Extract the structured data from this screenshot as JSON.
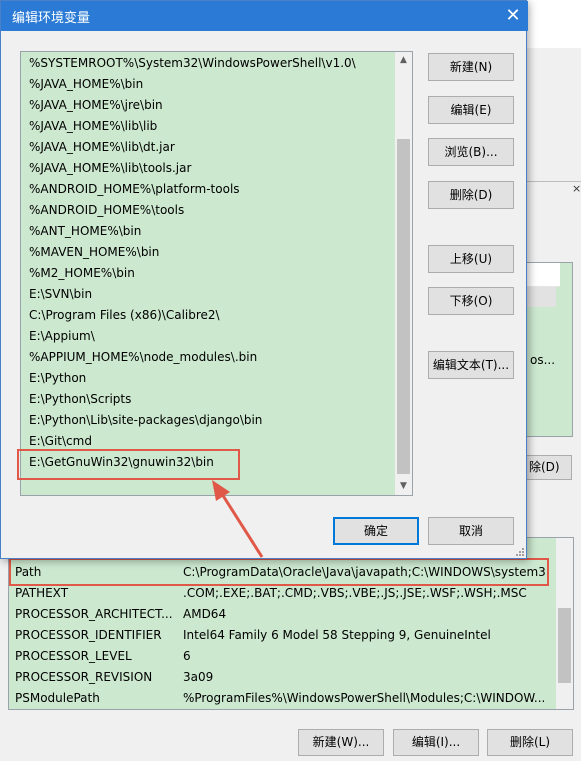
{
  "dialog": {
    "title": "编辑环境变量",
    "entries": [
      "%SYSTEMROOT%\\System32\\WindowsPowerShell\\v1.0\\",
      "%JAVA_HOME%\\bin",
      "%JAVA_HOME%\\jre\\bin",
      "%JAVA_HOME%\\lib\\lib",
      "%JAVA_HOME%\\lib\\dt.jar",
      "%JAVA_HOME%\\lib\\tools.jar",
      "%ANDROID_HOME%\\platform-tools",
      "%ANDROID_HOME%\\tools",
      "%ANT_HOME%\\bin",
      "%MAVEN_HOME%\\bin",
      "%M2_HOME%\\bin",
      "E:\\SVN\\bin",
      "C:\\Program Files (x86)\\Calibre2\\",
      "E:\\Appium\\",
      "%APPIUM_HOME%\\node_modules\\.bin",
      "E:\\Python",
      "E:\\Python\\Scripts",
      "E:\\Python\\Lib\\site-packages\\django\\bin",
      "E:\\Git\\cmd",
      "E:\\GetGnuWin32\\gnuwin32\\bin",
      ""
    ],
    "buttons": {
      "new": "新建(N)",
      "edit": "编辑(E)",
      "browse": "浏览(B)...",
      "delete": "删除(D)",
      "move_up": "上移(U)",
      "move_down": "下移(O)",
      "edit_text": "编辑文本(T)...",
      "ok": "确定",
      "cancel": "取消"
    }
  },
  "background": {
    "list_partial_text": "os...",
    "delete_button_partial": "除(D)",
    "close_glyph": "×"
  },
  "system_vars": {
    "rows": [
      {
        "name": "Path",
        "value": "C:\\ProgramData\\Oracle\\Java\\javapath;C:\\WINDOWS\\system3..."
      },
      {
        "name": "PATHEXT",
        "value": ".COM;.EXE;.BAT;.CMD;.VBS;.VBE;.JS;.JSE;.WSF;.WSH;.MSC"
      },
      {
        "name": "PROCESSOR_ARCHITECT...",
        "value": "AMD64"
      },
      {
        "name": "PROCESSOR_IDENTIFIER",
        "value": "Intel64 Family 6 Model 58 Stepping 9, GenuineIntel"
      },
      {
        "name": "PROCESSOR_LEVEL",
        "value": "6"
      },
      {
        "name": "PROCESSOR_REVISION",
        "value": "3a09"
      },
      {
        "name": "PSModulePath",
        "value": "%ProgramFiles%\\WindowsPowerShell\\Modules;C:\\WINDOW..."
      }
    ],
    "buttons": {
      "new": "新建(W)...",
      "edit": "编辑(I)...",
      "delete": "删除(L)"
    }
  },
  "colors": {
    "title_bar": "#2b7bd6",
    "list_bg": "#cce8cf",
    "annotation": "#e05848"
  }
}
